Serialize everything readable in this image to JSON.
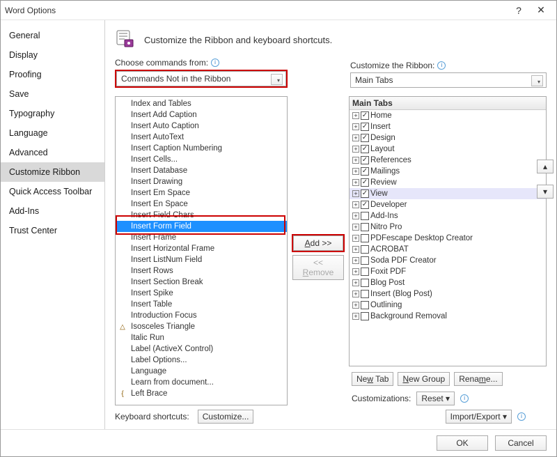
{
  "window": {
    "title": "Word Options"
  },
  "sidebar": {
    "items": [
      {
        "label": "General"
      },
      {
        "label": "Display"
      },
      {
        "label": "Proofing"
      },
      {
        "label": "Save"
      },
      {
        "label": "Typography"
      },
      {
        "label": "Language"
      },
      {
        "label": "Advanced"
      },
      {
        "label": "Customize Ribbon"
      },
      {
        "label": "Quick Access Toolbar"
      },
      {
        "label": "Add-Ins"
      },
      {
        "label": "Trust Center"
      }
    ],
    "selected_index": 7
  },
  "header": {
    "subtitle": "Customize the Ribbon and keyboard shortcuts.",
    "choose_label": "Choose commands from:",
    "choose_value": "Commands Not in the Ribbon",
    "customize_ribbon_label": "Customize the Ribbon:",
    "customize_ribbon_value": "Main Tabs"
  },
  "commands": {
    "selected_index": 11,
    "list": [
      "Index and Tables",
      "Insert Add Caption",
      "Insert Auto Caption",
      "Insert AutoText",
      "Insert Caption Numbering",
      "Insert Cells...",
      "Insert Database",
      "Insert Drawing",
      "Insert Em Space",
      "Insert En Space",
      "Insert Field Chars",
      "Insert Form Field",
      "Insert Frame",
      "Insert Horizontal Frame",
      "Insert ListNum Field",
      "Insert Rows",
      "Insert Section Break",
      "Insert Spike",
      "Insert Table",
      "Introduction Focus",
      "Isosceles Triangle",
      "Italic Run",
      "Label (ActiveX Control)",
      "Label Options...",
      "Language",
      "Learn from document...",
      "Left Brace"
    ]
  },
  "tabs": {
    "header": "Main Tabs",
    "highlight_index": 7,
    "items": [
      {
        "label": "Home",
        "checked": true
      },
      {
        "label": "Insert",
        "checked": true
      },
      {
        "label": "Design",
        "checked": true
      },
      {
        "label": "Layout",
        "checked": true
      },
      {
        "label": "References",
        "checked": true
      },
      {
        "label": "Mailings",
        "checked": true
      },
      {
        "label": "Review",
        "checked": true
      },
      {
        "label": "View",
        "checked": true
      },
      {
        "label": "Developer",
        "checked": true
      },
      {
        "label": "Add-Ins",
        "checked": false
      },
      {
        "label": "Nitro Pro",
        "checked": false
      },
      {
        "label": "PDFescape Desktop Creator",
        "checked": false
      },
      {
        "label": "ACROBAT",
        "checked": false
      },
      {
        "label": "Soda PDF Creator",
        "checked": false
      },
      {
        "label": "Foxit PDF",
        "checked": false
      },
      {
        "label": "Blog Post",
        "checked": false
      },
      {
        "label": "Insert (Blog Post)",
        "checked": false
      },
      {
        "label": "Outlining",
        "checked": false
      },
      {
        "label": "Background Removal",
        "checked": false
      }
    ]
  },
  "buttons": {
    "add": "Add >>",
    "remove": "<< Remove",
    "newtab": "New Tab",
    "newgroup": "New Group",
    "rename": "Rename...",
    "reset": "Reset ▾",
    "importexport": "Import/Export ▾",
    "customize": "Customize...",
    "customizations_label": "Customizations:",
    "kb_label": "Keyboard shortcuts:",
    "ok": "OK",
    "cancel": "Cancel"
  }
}
